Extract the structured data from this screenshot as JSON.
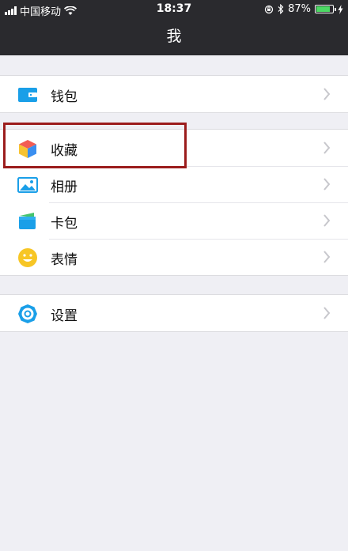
{
  "status_bar": {
    "carrier": "中国移动",
    "time": "18:37",
    "battery_text": "87%",
    "battery_level": 0.87,
    "icons": [
      "signal-icon",
      "wifi-icon",
      "orientation-lock-icon",
      "bluetooth-icon",
      "battery-icon",
      "charging-icon"
    ]
  },
  "nav": {
    "title": "我"
  },
  "groups": [
    {
      "items": [
        {
          "label": "钱包",
          "icon": "wallet-icon"
        }
      ]
    },
    {
      "items": [
        {
          "label": "收藏",
          "icon": "favorites-icon"
        },
        {
          "label": "相册",
          "icon": "album-icon"
        },
        {
          "label": "卡包",
          "icon": "card-package-icon"
        },
        {
          "label": "表情",
          "icon": "emoji-icon"
        }
      ]
    },
    {
      "items": [
        {
          "label": "设置",
          "icon": "settings-icon"
        }
      ]
    }
  ],
  "colors": {
    "navbar_bg": "#2a2a2e",
    "page_bg": "#efeff4",
    "highlight_border": "#9b1c1c",
    "battery_fill": "#4cd964"
  }
}
